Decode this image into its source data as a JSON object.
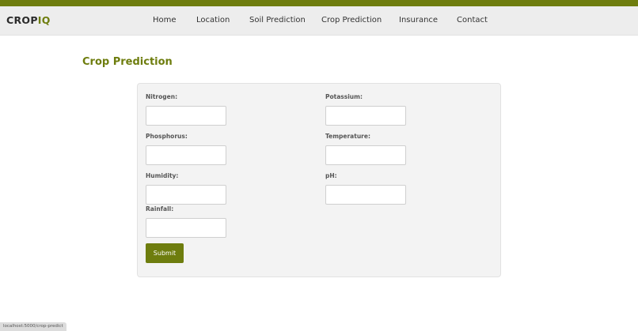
{
  "colors": {
    "accent": "#6e7d0e",
    "navbar_bg": "#ededed",
    "card_bg": "#f3f3f3"
  },
  "brand": {
    "part1": "CROP",
    "part2": "IQ"
  },
  "nav": {
    "home": "Home",
    "location": "Location",
    "soil_prediction": "Soil Prediction",
    "crop_prediction": "Crop Prediction",
    "insurance": "Insurance",
    "contact": "Contact"
  },
  "page": {
    "title": "Crop Prediction"
  },
  "form": {
    "nitrogen": {
      "label": "Nitrogen:",
      "value": ""
    },
    "potassium": {
      "label": "Potassium:",
      "value": ""
    },
    "phosphorus": {
      "label": "Phosphorus:",
      "value": ""
    },
    "temperature": {
      "label": "Temperature:",
      "value": ""
    },
    "humidity": {
      "label": "Humidity:",
      "value": ""
    },
    "ph": {
      "label": "pH:",
      "value": ""
    },
    "rainfall": {
      "label": "Rainfall:",
      "value": ""
    },
    "submit_label": "Submit"
  },
  "status_bar": {
    "url": "localhost:5000/crop-predict"
  }
}
